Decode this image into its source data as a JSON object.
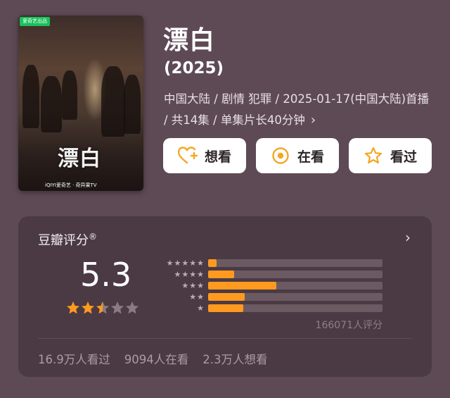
{
  "poster": {
    "badge": "爱奇艺出品",
    "title": "漂白",
    "platforms": "iQIYI爱奇艺 · 奇异果TV"
  },
  "header": {
    "title": "漂白",
    "year": "(2025)",
    "meta": "中国大陆 / 剧情 犯罪 / 2025-01-17(中国大陆)首播 / 共14集 / 单集片长40分钟"
  },
  "actions": [
    {
      "label": "想看",
      "icon": "heart-plus-icon"
    },
    {
      "label": "在看",
      "icon": "target-icon"
    },
    {
      "label": "看过",
      "icon": "star-outline-icon"
    }
  ],
  "rating": {
    "label": "豆瓣评分",
    "registered_mark": "®",
    "score": "5.3",
    "star_value": 2.5,
    "distribution": [
      {
        "stars": 5,
        "fraction": 0.05
      },
      {
        "stars": 4,
        "fraction": 0.15
      },
      {
        "stars": 3,
        "fraction": 0.39
      },
      {
        "stars": 2,
        "fraction": 0.21
      },
      {
        "stars": 1,
        "fraction": 0.2
      }
    ],
    "count_label": "166071人评分"
  },
  "stats": {
    "watched": "16.9万人看过",
    "watching": "9094人在看",
    "want": "2.3万人想看"
  },
  "colors": {
    "background": "#5e4a55",
    "card": "#4b3a43",
    "accent": "#ff9a1f",
    "button_icon": "#f5a623"
  }
}
